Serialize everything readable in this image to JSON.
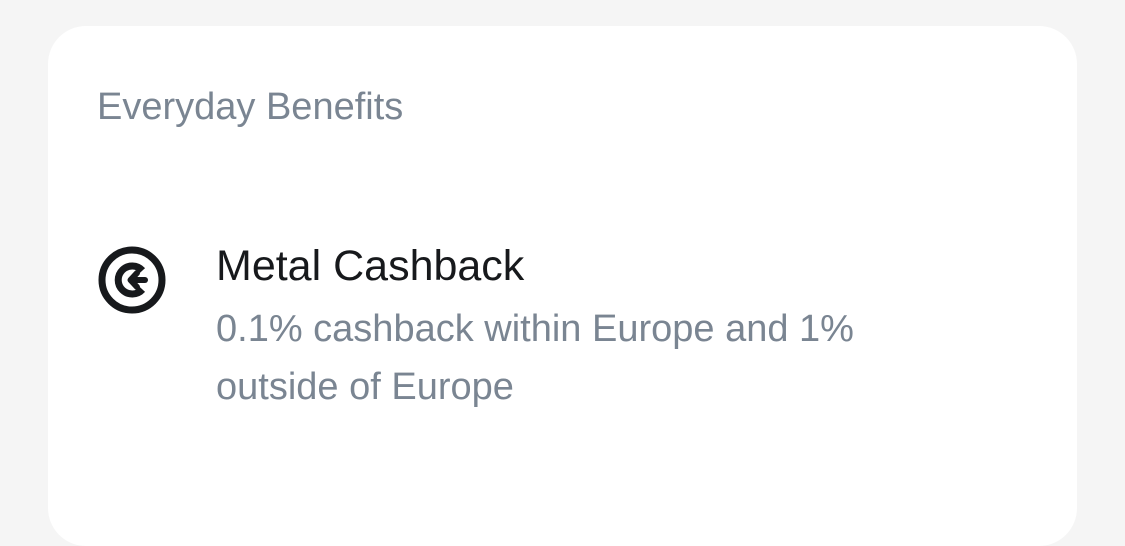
{
  "colors": {
    "page_background": "#f5f5f5",
    "card_background": "#ffffff",
    "primary_text": "#17191c",
    "secondary_text": "#7a8592"
  },
  "section": {
    "title": "Everyday Benefits"
  },
  "benefits": [
    {
      "icon": "cashback-icon",
      "title": "Metal Cashback",
      "description": "0.1% cashback within Europe and 1% outside of Europe"
    }
  ]
}
